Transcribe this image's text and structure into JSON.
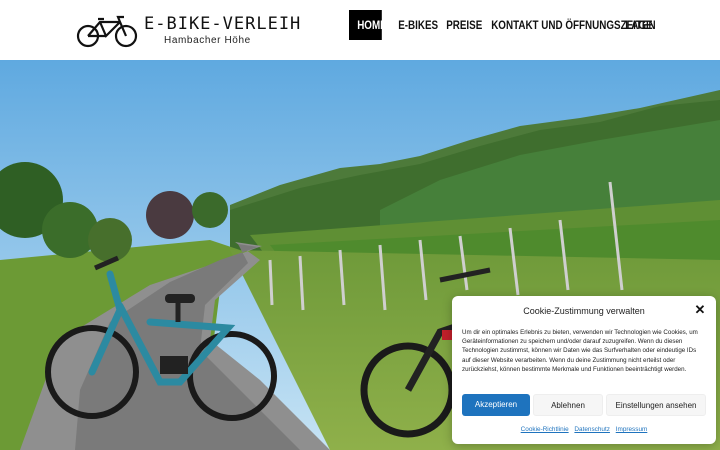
{
  "site": {
    "title": "E-BIKE-VERLEIH",
    "subtitle": "Hambacher Höhe",
    "logo_icon": "bicycle-icon"
  },
  "nav": {
    "items": [
      {
        "label": "HOME",
        "active": true
      },
      {
        "label": "E-BIKES",
        "active": false
      },
      {
        "label": "PREISE",
        "active": false
      },
      {
        "label": "KONTAKT UND ÖFFNUNGSZEITEN",
        "active": false
      },
      {
        "label": "LAGE",
        "active": false
      }
    ]
  },
  "hero": {
    "image": "vineyard-path-with-e-bikes"
  },
  "cookie_banner": {
    "title": "Cookie-Zustimmung verwalten",
    "close_icon": "close-icon",
    "text": "Um dir ein optimales Erlebnis zu bieten, verwenden wir Technologien wie Cookies, um Geräteinformationen zu speichern und/oder darauf zuzugreifen. Wenn du diesen Technologien zustimmst, können wir Daten wie das Surfverhalten oder eindeutige IDs auf dieser Website verarbeiten. Wenn du deine Zustimmung nicht erteilst oder zurückziehst, können bestimmte Merkmale und Funktionen beeinträchtigt werden.",
    "accept_label": "Akzeptieren",
    "deny_label": "Ablehnen",
    "settings_label": "Einstellungen ansehen",
    "links": [
      "Cookie-Richtlinie",
      "Datenschutz",
      "Impressum"
    ]
  },
  "colors": {
    "accent": "#1e73be",
    "nav_active_bg": "#000000",
    "sky": "#8cc4ea"
  }
}
